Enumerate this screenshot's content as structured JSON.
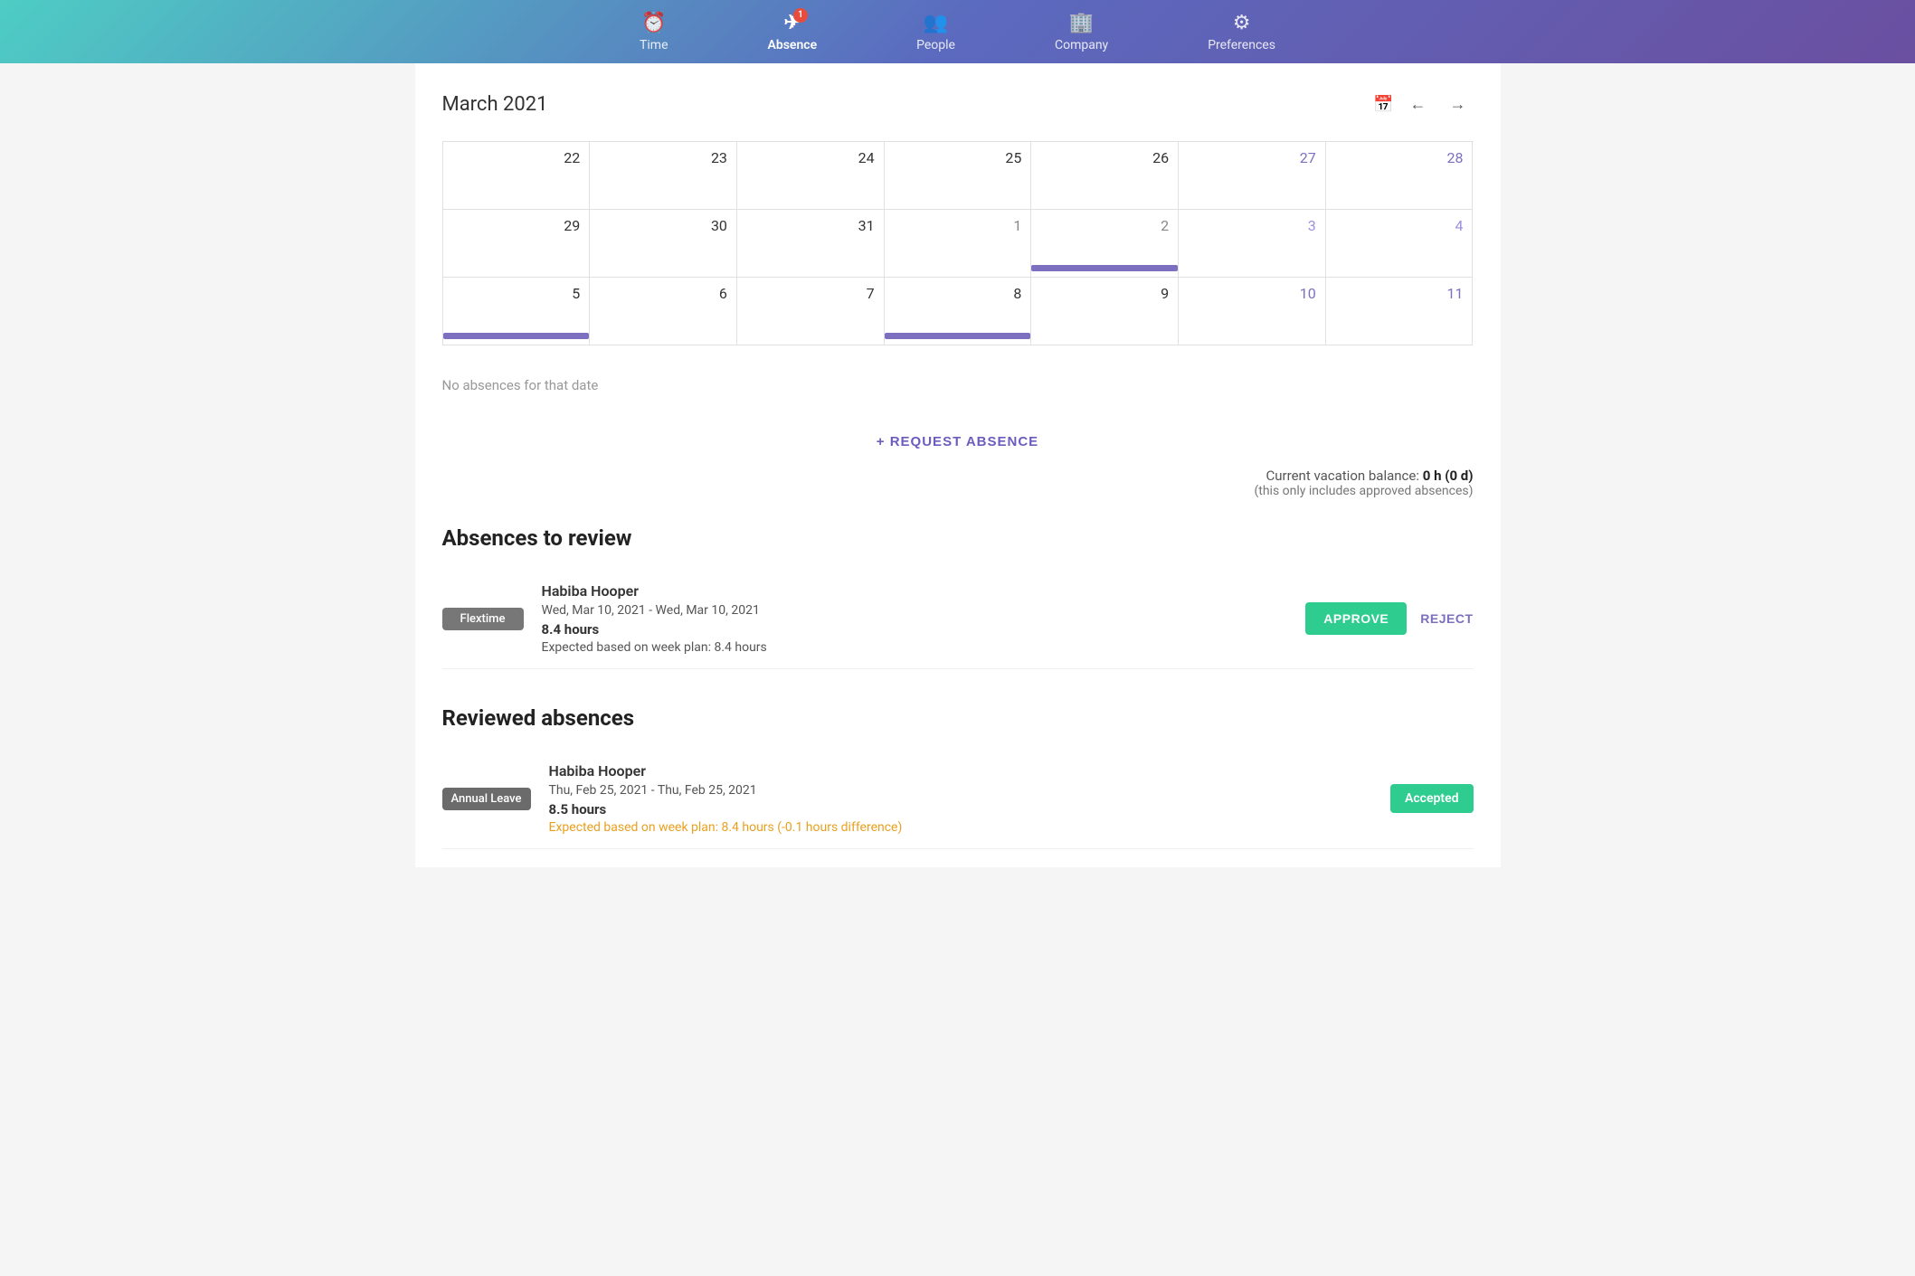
{
  "nav": {
    "items": [
      {
        "id": "time",
        "label": "Time",
        "icon": "⏰",
        "active": false,
        "badge": null
      },
      {
        "id": "absence",
        "label": "Absence",
        "icon": "✈",
        "active": true,
        "badge": "1"
      },
      {
        "id": "people",
        "label": "People",
        "icon": "👥",
        "active": false,
        "badge": null
      },
      {
        "id": "company",
        "label": "Company",
        "icon": "🏢",
        "active": false,
        "badge": null
      },
      {
        "id": "preferences",
        "label": "Preferences",
        "icon": "⚙",
        "active": false,
        "badge": null
      }
    ]
  },
  "calendar": {
    "title": "March 2021",
    "rows": [
      [
        {
          "day": "22",
          "type": "normal"
        },
        {
          "day": "23",
          "type": "normal"
        },
        {
          "day": "24",
          "type": "normal"
        },
        {
          "day": "25",
          "type": "normal"
        },
        {
          "day": "26",
          "type": "normal"
        },
        {
          "day": "27",
          "type": "weekend"
        },
        {
          "day": "28",
          "type": "weekend"
        }
      ],
      [
        {
          "day": "29",
          "type": "normal"
        },
        {
          "day": "30",
          "type": "normal"
        },
        {
          "day": "31",
          "type": "normal"
        },
        {
          "day": "1",
          "type": "other-month"
        },
        {
          "day": "2",
          "type": "other-month",
          "event": true
        },
        {
          "day": "3",
          "type": "weekend other-month"
        },
        {
          "day": "4",
          "type": "weekend other-month"
        }
      ],
      [
        {
          "day": "5",
          "type": "normal",
          "event": true
        },
        {
          "day": "6",
          "type": "normal"
        },
        {
          "day": "7",
          "type": "normal"
        },
        {
          "day": "8",
          "type": "normal",
          "event": true
        },
        {
          "day": "9",
          "type": "normal"
        },
        {
          "day": "10",
          "type": "weekend"
        },
        {
          "day": "11",
          "type": "weekend"
        }
      ]
    ]
  },
  "no_absences_text": "No absences for that date",
  "request_absence_label": "+ REQUEST ABSENCE",
  "vacation_balance": {
    "label": "Current vacation balance:",
    "value": "0 h (0 d)",
    "sub": "(this only includes approved absences)"
  },
  "absences_to_review": {
    "title": "Absences to review",
    "items": [
      {
        "badge": "Flextime",
        "name": "Habiba Hooper",
        "dates": "Wed, Mar 10, 2021 - Wed, Mar 10, 2021",
        "hours": "8.4 hours",
        "expected": "Expected based on week plan: 8.4 hours",
        "expected_warning": false,
        "approve_label": "APPROVE",
        "reject_label": "REJECT"
      }
    ]
  },
  "reviewed_absences": {
    "title": "Reviewed absences",
    "items": [
      {
        "badge": "Annual Leave",
        "name": "Habiba Hooper",
        "dates": "Thu, Feb 25, 2021 - Thu, Feb 25, 2021",
        "hours": "8.5 hours",
        "expected": "Expected based on week plan: 8.4 hours (-0.1 hours difference)",
        "expected_warning": true,
        "status_label": "Accepted"
      }
    ]
  }
}
